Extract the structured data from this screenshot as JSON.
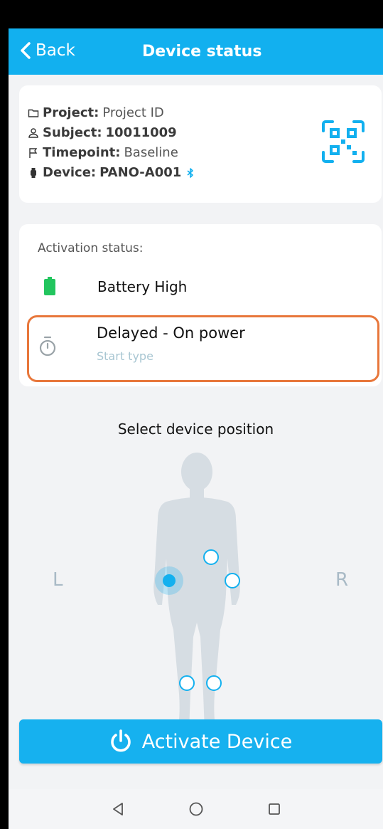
{
  "header": {
    "back_label": "Back",
    "title": "Device status"
  },
  "info": {
    "project_label": "Project:",
    "project_value": "Project ID",
    "subject_label": "Subject:",
    "subject_value": "10011009",
    "timepoint_label": "Timepoint:",
    "timepoint_value": "Baseline",
    "device_label": "Device:",
    "device_value": "PANO-A001",
    "icons": [
      "folder-icon",
      "person-icon",
      "flag-icon",
      "watch-icon",
      "bluetooth-icon",
      "qr-code-icon"
    ]
  },
  "activation": {
    "label": "Activation status:",
    "battery_text": "Battery High",
    "delay_main": "Delayed -  On power",
    "delay_sub": "Start type"
  },
  "position": {
    "title": "Select device position",
    "left_label": "L",
    "right_label": "R"
  },
  "actions": {
    "activate_label": "Activate Device"
  },
  "colors": {
    "accent": "#12b0ef",
    "battery": "#22c55e",
    "highlight_border": "#e8773b"
  }
}
